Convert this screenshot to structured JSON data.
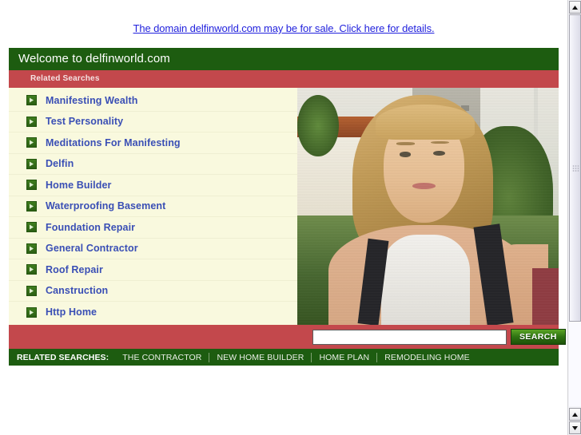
{
  "page": {
    "sale_link": "The domain delfinworld.com may be for sale. Click here for details."
  },
  "card": {
    "title": "Welcome to delfinworld.com",
    "subtitle": "Related Searches"
  },
  "related_links": [
    {
      "label": "Manifesting Wealth"
    },
    {
      "label": "Test Personality"
    },
    {
      "label": "Meditations For Manifesting"
    },
    {
      "label": "Delfin"
    },
    {
      "label": "Home Builder"
    },
    {
      "label": "Waterproofing Basement"
    },
    {
      "label": "Foundation Repair"
    },
    {
      "label": "General Contractor"
    },
    {
      "label": "Roof Repair"
    },
    {
      "label": "Canstruction"
    },
    {
      "label": "Http Home"
    }
  ],
  "search": {
    "value": "",
    "placeholder": "",
    "button_label": "SEARCH"
  },
  "footer": {
    "label": "RELATED SEARCHES:",
    "items": [
      {
        "label": "THE CONTRACTOR"
      },
      {
        "label": "NEW HOME BUILDER"
      },
      {
        "label": "HOME PLAN"
      },
      {
        "label": "REMODELING HOME"
      }
    ]
  },
  "colors": {
    "green_dark": "#1d5c10",
    "red": "#c3484c",
    "cream": "#f9f9de",
    "link_blue": "#3a4fb5",
    "sale_link_blue": "#2222dd"
  },
  "icons": {
    "bullet": "arrow-right-icon",
    "scroll_up": "scroll-up-arrow-icon",
    "scroll_down": "scroll-down-arrow-icon"
  }
}
